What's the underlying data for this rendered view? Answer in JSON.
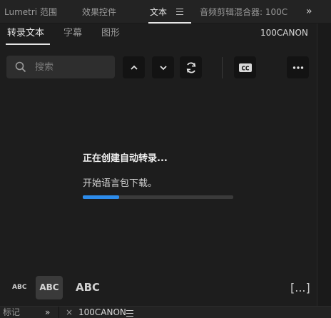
{
  "panel_tabs": [
    {
      "label": "Lumetri 范围"
    },
    {
      "label": "效果控件"
    },
    {
      "label": "文本"
    },
    {
      "label": "音频剪辑混合器: 100C"
    }
  ],
  "overflow_label": "»",
  "sub_tabs": [
    {
      "label": "转录文本"
    },
    {
      "label": "字幕"
    },
    {
      "label": "图形"
    }
  ],
  "sequence_name": "100CANON",
  "search": {
    "placeholder": "搜索",
    "value": ""
  },
  "status": {
    "title": "正在创建自动转录...",
    "subtitle": "开始语言包下载。",
    "progress_fraction": 0.24,
    "progress_color": "#2d8ceb"
  },
  "text_size": {
    "small": "ABC",
    "medium": "ABC",
    "large": "ABC",
    "more": "[...]"
  },
  "bottom_tabs": {
    "left_label": "标记",
    "left_overflow": "»",
    "close": "×",
    "sequence": "100CANON"
  }
}
